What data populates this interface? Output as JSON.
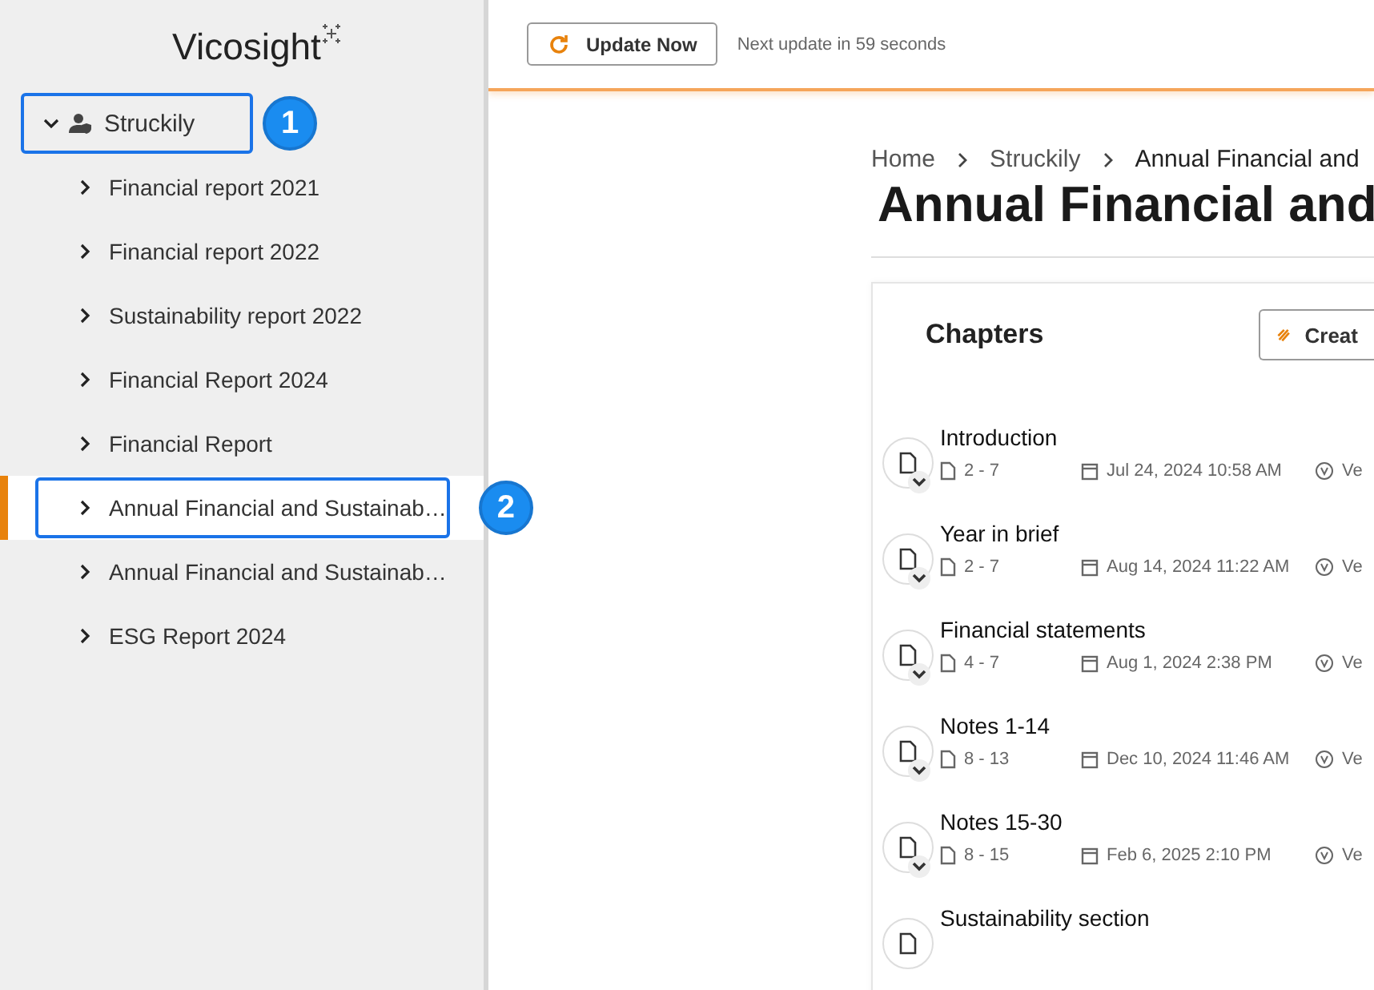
{
  "sidebar": {
    "logo": "Vicosight",
    "tree": [
      {
        "label": "Struckily",
        "expanded": true,
        "highlighted": true,
        "callout": "1",
        "children": [
          {
            "label": "Financial report 2021",
            "expanded": false,
            "selected": false,
            "highlighted": false
          },
          {
            "label": "Financial report 2022",
            "expanded": false,
            "selected": false,
            "highlighted": false
          },
          {
            "label": "Sustainability report 2022",
            "expanded": false,
            "selected": false,
            "highlighted": false
          },
          {
            "label": "Financial Report 2024",
            "expanded": false,
            "selected": false,
            "highlighted": false
          },
          {
            "label": "Financial Report",
            "expanded": false,
            "selected": false,
            "highlighted": false
          },
          {
            "label": "Annual Financial and Sustainab…",
            "expanded": false,
            "selected": true,
            "highlighted": true,
            "callout": "2"
          },
          {
            "label": "Annual Financial and Sustainab…",
            "expanded": false,
            "selected": false,
            "highlighted": false
          },
          {
            "label": "ESG Report 2024",
            "expanded": false,
            "selected": false,
            "highlighted": false
          }
        ]
      }
    ]
  },
  "top_bar": {
    "update_button": "Update Now",
    "status": "Next update in 59 seconds"
  },
  "breadcrumb": [
    "Home",
    "Struckily",
    "Annual Financial and"
  ],
  "page_title": "Annual Financial and",
  "chapters": {
    "heading": "Chapters",
    "create_button": "Creat",
    "rows": [
      {
        "title": "Introduction",
        "pages": "2 - 7",
        "date": "Jul 24, 2024 10:58 AM",
        "column_3": "Ve"
      },
      {
        "title": "Year in brief",
        "pages": "2 - 7",
        "date": "Aug 14, 2024 11:22 AM",
        "column_3": "Ve"
      },
      {
        "title": "Financial statements",
        "pages": "4 - 7",
        "date": "Aug 1, 2024 2:38 PM",
        "column_3": "Ve"
      },
      {
        "title": "Notes 1-14",
        "pages": "8 - 13",
        "date": "Dec 10, 2024 11:46 AM",
        "column_3": "Ve"
      },
      {
        "title": "Notes 15-30",
        "pages": "8 - 15",
        "date": "Feb 6, 2025 2:10 PM",
        "column_3": "Ve"
      },
      {
        "title": "Sustainability section"
      }
    ]
  }
}
